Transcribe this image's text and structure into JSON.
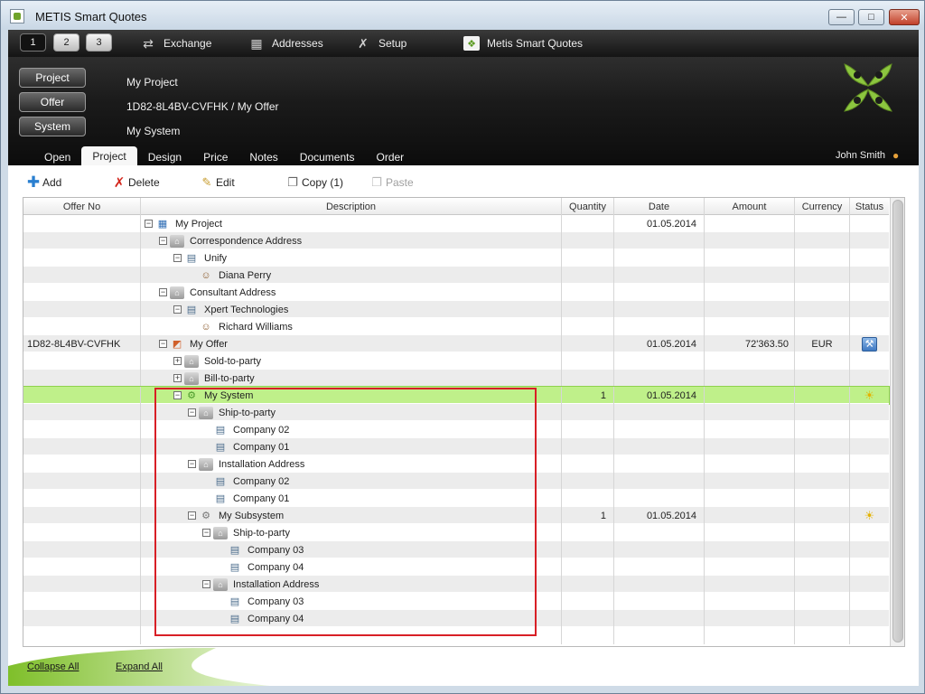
{
  "window": {
    "title": "METIS Smart Quotes",
    "controls": {
      "minimize": "—",
      "maximize": "□",
      "close": "✕"
    }
  },
  "topnav": {
    "pages": [
      "1",
      "2",
      "3"
    ],
    "items": [
      {
        "label": "Exchange",
        "icon": "exchange-icon"
      },
      {
        "label": "Addresses",
        "icon": "addresses-icon"
      },
      {
        "label": "Setup",
        "icon": "setup-icon"
      },
      {
        "label": "Metis Smart Quotes",
        "icon": "metis-icon"
      }
    ]
  },
  "header": {
    "buttons": {
      "project": "Project",
      "offer": "Offer",
      "system": "System"
    },
    "project_name": "My Project",
    "offer_path": "1D82-8L4BV-CVFHK / My Offer",
    "system_name": "My System",
    "user": "John Smith"
  },
  "tabs": [
    "Open",
    "Project",
    "Design",
    "Price",
    "Notes",
    "Documents",
    "Order"
  ],
  "active_tab": "Project",
  "toolbar": {
    "add": "Add",
    "delete": "Delete",
    "edit": "Edit",
    "copy": "Copy (1)",
    "paste": "Paste"
  },
  "grid": {
    "columns": {
      "offer_no": "Offer No",
      "description": "Description",
      "quantity": "Quantity",
      "date": "Date",
      "amount": "Amount",
      "currency": "Currency",
      "status": "Status"
    },
    "rows": [
      {
        "offer": "",
        "label": "My Project",
        "level": 0,
        "exp": "−",
        "icon": "project",
        "qty": "",
        "date": "01.05.2014",
        "amount": "",
        "cur": "",
        "status": ""
      },
      {
        "offer": "",
        "label": "Correspondence Address",
        "level": 1,
        "exp": "−",
        "icon": "folder",
        "qty": "",
        "date": "",
        "amount": "",
        "cur": "",
        "status": ""
      },
      {
        "offer": "",
        "label": "Unify",
        "level": 2,
        "exp": "−",
        "icon": "company",
        "qty": "",
        "date": "",
        "amount": "",
        "cur": "",
        "status": ""
      },
      {
        "offer": "",
        "label": "Diana Perry",
        "level": 3,
        "exp": "",
        "icon": "person",
        "qty": "",
        "date": "",
        "amount": "",
        "cur": "",
        "status": ""
      },
      {
        "offer": "",
        "label": "Consultant Address",
        "level": 1,
        "exp": "−",
        "icon": "folder",
        "qty": "",
        "date": "",
        "amount": "",
        "cur": "",
        "status": ""
      },
      {
        "offer": "",
        "label": "Xpert Technologies",
        "level": 2,
        "exp": "−",
        "icon": "company",
        "qty": "",
        "date": "",
        "amount": "",
        "cur": "",
        "status": ""
      },
      {
        "offer": "",
        "label": "Richard Williams",
        "level": 3,
        "exp": "",
        "icon": "person",
        "qty": "",
        "date": "",
        "amount": "",
        "cur": "",
        "status": ""
      },
      {
        "offer": "1D82-8L4BV-CVFHK",
        "label": "My Offer",
        "level": 1,
        "exp": "−",
        "icon": "offer",
        "qty": "",
        "date": "01.05.2014",
        "amount": "72'363.50",
        "cur": "EUR",
        "status": "tools"
      },
      {
        "offer": "",
        "label": "Sold-to-party",
        "level": 2,
        "exp": "+",
        "icon": "folder",
        "qty": "",
        "date": "",
        "amount": "",
        "cur": "",
        "status": ""
      },
      {
        "offer": "",
        "label": "Bill-to-party",
        "level": 2,
        "exp": "+",
        "icon": "folder",
        "qty": "",
        "date": "",
        "amount": "",
        "cur": "",
        "status": ""
      },
      {
        "offer": "",
        "label": "My System",
        "level": 2,
        "exp": "−",
        "icon": "system",
        "qty": "1",
        "date": "01.05.2014",
        "amount": "",
        "cur": "",
        "status": "bulb",
        "selected": true
      },
      {
        "offer": "",
        "label": "Ship-to-party",
        "level": 3,
        "exp": "−",
        "icon": "folder",
        "qty": "",
        "date": "",
        "amount": "",
        "cur": "",
        "status": ""
      },
      {
        "offer": "",
        "label": "Company 02",
        "level": 4,
        "exp": "",
        "icon": "company",
        "qty": "",
        "date": "",
        "amount": "",
        "cur": "",
        "status": ""
      },
      {
        "offer": "",
        "label": "Company 01",
        "level": 4,
        "exp": "",
        "icon": "company",
        "qty": "",
        "date": "",
        "amount": "",
        "cur": "",
        "status": ""
      },
      {
        "offer": "",
        "label": "Installation Address",
        "level": 3,
        "exp": "−",
        "icon": "folder",
        "qty": "",
        "date": "",
        "amount": "",
        "cur": "",
        "status": ""
      },
      {
        "offer": "",
        "label": "Company 02",
        "level": 4,
        "exp": "",
        "icon": "company",
        "qty": "",
        "date": "",
        "amount": "",
        "cur": "",
        "status": ""
      },
      {
        "offer": "",
        "label": "Company 01",
        "level": 4,
        "exp": "",
        "icon": "company",
        "qty": "",
        "date": "",
        "amount": "",
        "cur": "",
        "status": ""
      },
      {
        "offer": "",
        "label": "My Subsystem",
        "level": 3,
        "exp": "−",
        "icon": "subsys",
        "qty": "1",
        "date": "01.05.2014",
        "amount": "",
        "cur": "",
        "status": "bulb"
      },
      {
        "offer": "",
        "label": "Ship-to-party",
        "level": 4,
        "exp": "−",
        "icon": "folder",
        "qty": "",
        "date": "",
        "amount": "",
        "cur": "",
        "status": ""
      },
      {
        "offer": "",
        "label": "Company 03",
        "level": 5,
        "exp": "",
        "icon": "company",
        "qty": "",
        "date": "",
        "amount": "",
        "cur": "",
        "status": ""
      },
      {
        "offer": "",
        "label": "Company 04",
        "level": 5,
        "exp": "",
        "icon": "company",
        "qty": "",
        "date": "",
        "amount": "",
        "cur": "",
        "status": ""
      },
      {
        "offer": "",
        "label": "Installation Address",
        "level": 4,
        "exp": "−",
        "icon": "folder",
        "qty": "",
        "date": "",
        "amount": "",
        "cur": "",
        "status": ""
      },
      {
        "offer": "",
        "label": "Company 03",
        "level": 5,
        "exp": "",
        "icon": "company",
        "qty": "",
        "date": "",
        "amount": "",
        "cur": "",
        "status": ""
      },
      {
        "offer": "",
        "label": "Company 04",
        "level": 5,
        "exp": "",
        "icon": "company",
        "qty": "",
        "date": "",
        "amount": "",
        "cur": "",
        "status": ""
      },
      {
        "offer": "",
        "label": "",
        "level": 0,
        "exp": "",
        "icon": "",
        "qty": "",
        "date": "",
        "amount": "",
        "cur": "",
        "status": ""
      }
    ]
  },
  "footer": {
    "collapse_all": "Collapse All",
    "expand_all": "Expand All"
  },
  "colors": {
    "selection": "#bff08a",
    "highlight_box": "#d81f26",
    "brand_green": "#8cc63f"
  }
}
